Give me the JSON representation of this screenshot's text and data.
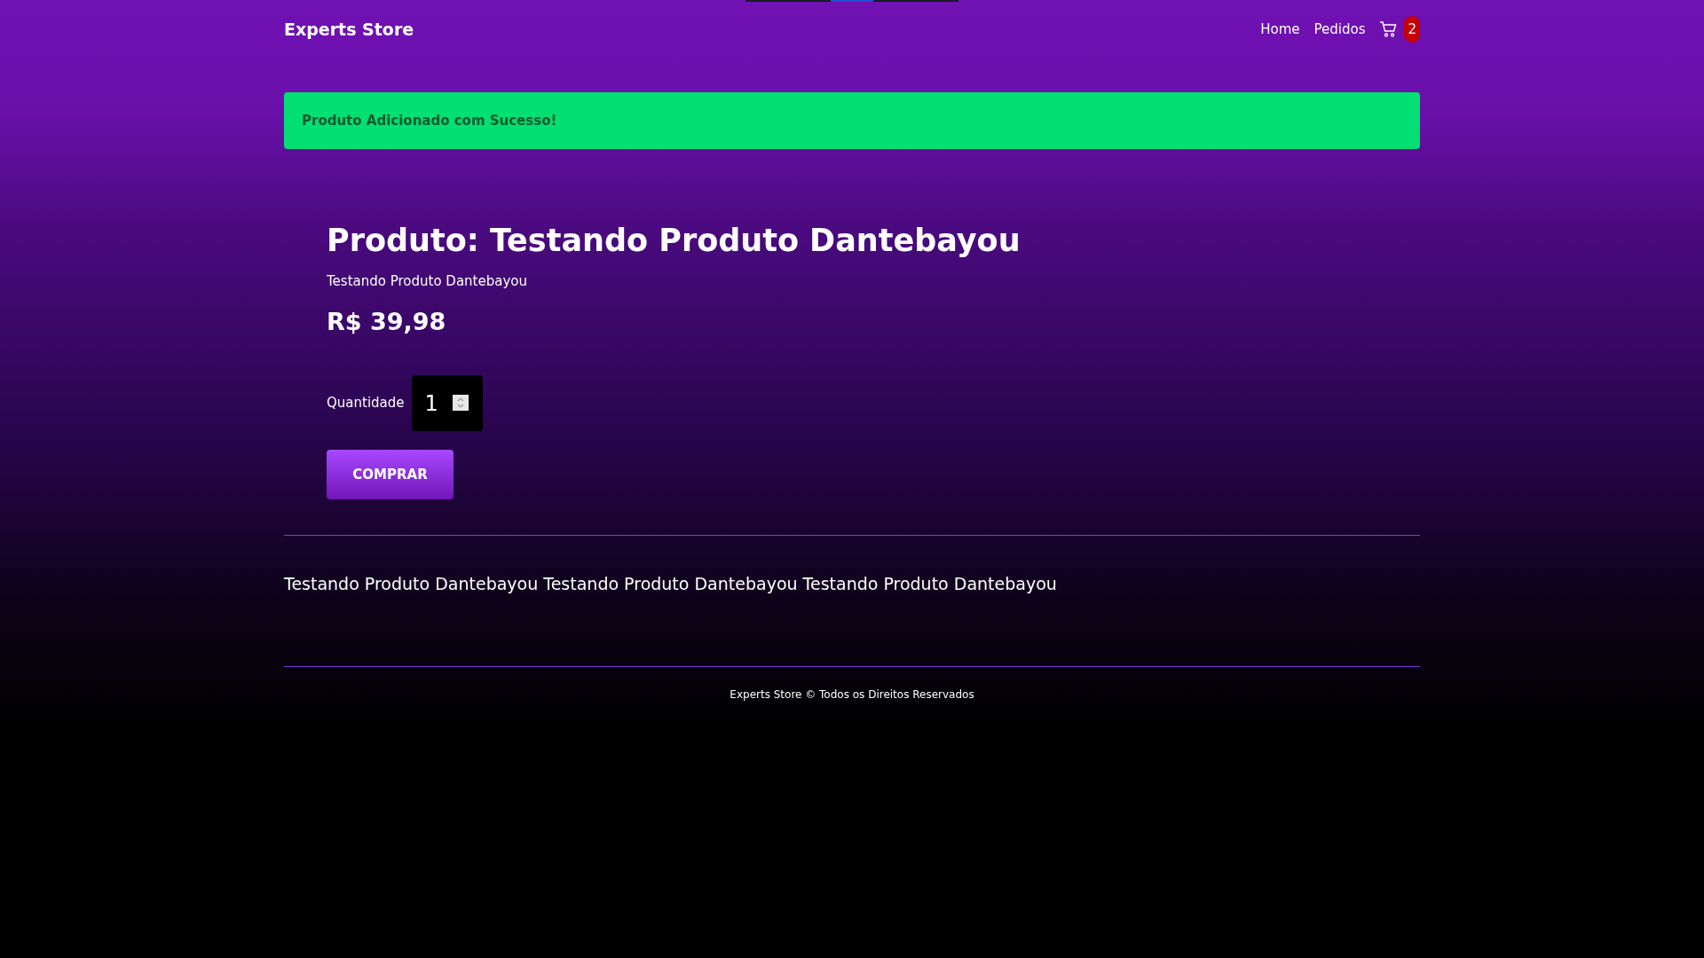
{
  "navbar": {
    "brand": "Experts Store",
    "links": [
      "Home",
      "Pedidos"
    ],
    "cart_count": "2"
  },
  "alert": {
    "text": "Produto Adicionado com Sucesso!"
  },
  "product": {
    "title": "Produto: Testando Produto Dantebayou",
    "subtitle": "Testando Produto Dantebayou",
    "price": "R$ 39,98",
    "quantity_label": "Quantidade",
    "quantity": "1",
    "buy_button": "COMPRAR"
  },
  "description": "Testando Produto Dantebayou Testando Produto Dantebayou Testando Produto Dantebayou",
  "footer": "Experts Store © Todos os Direitos Reservados"
}
